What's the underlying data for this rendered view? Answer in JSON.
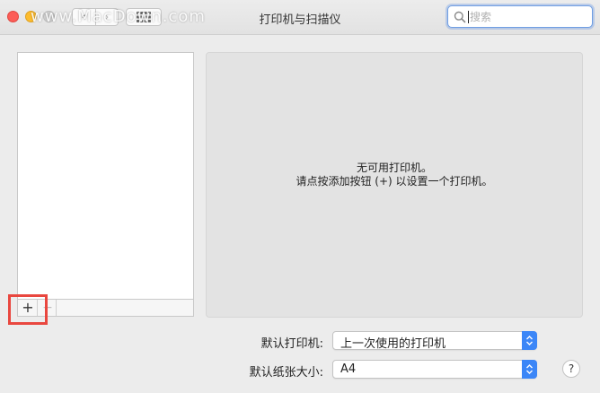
{
  "window": {
    "title": "打印机与扫描仪",
    "watermark": "www.MacDown.com"
  },
  "toolbar": {
    "back_icon": "chevron-left-icon",
    "forward_icon": "chevron-right-icon",
    "grid_icon": "grid-icon"
  },
  "search": {
    "placeholder": "搜索",
    "icon": "search-icon"
  },
  "printer_list": {
    "items": [],
    "add_label": "+",
    "remove_label": "−"
  },
  "detail": {
    "line1": "无可用打印机。",
    "line2": "请点按添加按钮 (+) 以设置一个打印机。"
  },
  "defaults": {
    "default_printer_label": "默认打印机:",
    "default_printer_value": "上一次使用的打印机",
    "default_paper_label": "默认纸张大小:",
    "default_paper_value": "A4"
  },
  "help_label": "?",
  "colors": {
    "accent": "#3b86f7",
    "highlight": "#e9473f"
  }
}
